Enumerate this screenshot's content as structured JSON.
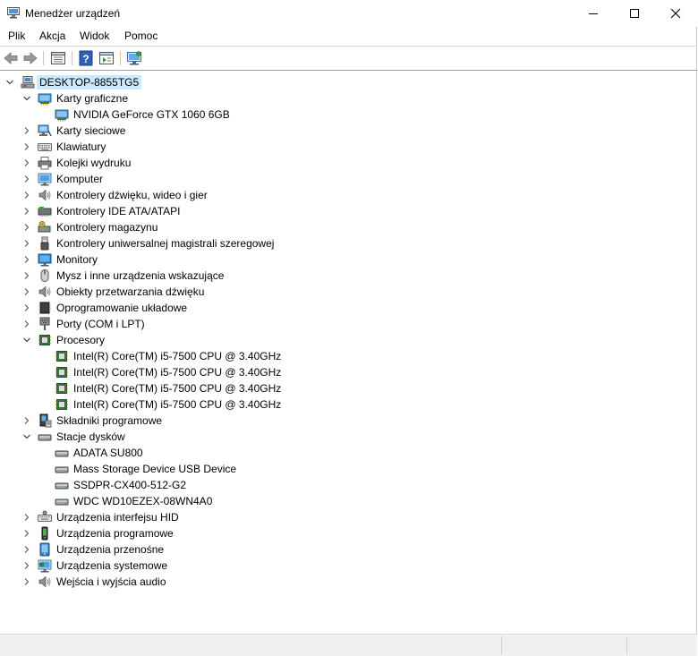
{
  "window": {
    "title": "Menedżer urządzeń"
  },
  "menu": [
    "Plik",
    "Akcja",
    "Widok",
    "Pomoc"
  ],
  "toolbar": [
    "back-icon",
    "forward-icon",
    "properties-view-icon",
    "help-icon",
    "action-view-icon",
    "monitor-scan-icon"
  ],
  "tree": {
    "root": "DESKTOP-8855TG5",
    "items": [
      {
        "level": 1,
        "expander": "open",
        "icon": "display-adapter",
        "label": "Karty graficzne"
      },
      {
        "level": 2,
        "expander": "none",
        "icon": "display-adapter",
        "label": "NVIDIA GeForce GTX 1060 6GB"
      },
      {
        "level": 1,
        "expander": "closed",
        "icon": "network",
        "label": "Karty sieciowe"
      },
      {
        "level": 1,
        "expander": "closed",
        "icon": "keyboard",
        "label": "Klawiatury"
      },
      {
        "level": 1,
        "expander": "closed",
        "icon": "printer",
        "label": "Kolejki wydruku"
      },
      {
        "level": 1,
        "expander": "closed",
        "icon": "computer",
        "label": "Komputer"
      },
      {
        "level": 1,
        "expander": "closed",
        "icon": "speaker",
        "label": "Kontrolery dźwięku, wideo i gier"
      },
      {
        "level": 1,
        "expander": "closed",
        "icon": "ide",
        "label": "Kontrolery IDE ATA/ATAPI"
      },
      {
        "level": 1,
        "expander": "closed",
        "icon": "storage-ctrl",
        "label": "Kontrolery magazynu"
      },
      {
        "level": 1,
        "expander": "closed",
        "icon": "usb",
        "label": "Kontrolery uniwersalnej magistrali szeregowej"
      },
      {
        "level": 1,
        "expander": "closed",
        "icon": "monitor",
        "label": "Monitory"
      },
      {
        "level": 1,
        "expander": "closed",
        "icon": "mouse",
        "label": "Mysz i inne urządzenia wskazujące"
      },
      {
        "level": 1,
        "expander": "closed",
        "icon": "speaker",
        "label": "Obiekty przetwarzania dźwięku"
      },
      {
        "level": 1,
        "expander": "closed",
        "icon": "firmware",
        "label": "Oprogramowanie układowe"
      },
      {
        "level": 1,
        "expander": "closed",
        "icon": "port",
        "label": "Porty (COM i LPT)"
      },
      {
        "level": 1,
        "expander": "open",
        "icon": "processor",
        "label": "Procesory"
      },
      {
        "level": 2,
        "expander": "none",
        "icon": "processor",
        "label": "Intel(R) Core(TM) i5-7500 CPU @ 3.40GHz"
      },
      {
        "level": 2,
        "expander": "none",
        "icon": "processor",
        "label": "Intel(R) Core(TM) i5-7500 CPU @ 3.40GHz"
      },
      {
        "level": 2,
        "expander": "none",
        "icon": "processor",
        "label": "Intel(R) Core(TM) i5-7500 CPU @ 3.40GHz"
      },
      {
        "level": 2,
        "expander": "none",
        "icon": "processor",
        "label": "Intel(R) Core(TM) i5-7500 CPU @ 3.40GHz"
      },
      {
        "level": 1,
        "expander": "closed",
        "icon": "software-comp",
        "label": "Składniki programowe"
      },
      {
        "level": 1,
        "expander": "open",
        "icon": "disk",
        "label": "Stacje dysków"
      },
      {
        "level": 2,
        "expander": "none",
        "icon": "disk",
        "label": "ADATA SU800"
      },
      {
        "level": 2,
        "expander": "none",
        "icon": "disk",
        "label": "Mass Storage Device USB Device"
      },
      {
        "level": 2,
        "expander": "none",
        "icon": "disk",
        "label": "SSDPR-CX400-512-G2"
      },
      {
        "level": 2,
        "expander": "none",
        "icon": "disk",
        "label": "WDC WD10EZEX-08WN4A0"
      },
      {
        "level": 1,
        "expander": "closed",
        "icon": "hid",
        "label": "Urządzenia interfejsu HID"
      },
      {
        "level": 1,
        "expander": "closed",
        "icon": "software-device",
        "label": "Urządzenia programowe"
      },
      {
        "level": 1,
        "expander": "closed",
        "icon": "portable",
        "label": "Urządzenia przenośne"
      },
      {
        "level": 1,
        "expander": "closed",
        "icon": "system",
        "label": "Urządzenia systemowe"
      },
      {
        "level": 1,
        "expander": "closed",
        "icon": "speaker",
        "label": "Wejścia i wyjścia audio"
      }
    ]
  },
  "colors": {
    "selection": "#cce8ff",
    "icon_blue": "#3a8fd6",
    "chip_green": "#2f7d32"
  }
}
